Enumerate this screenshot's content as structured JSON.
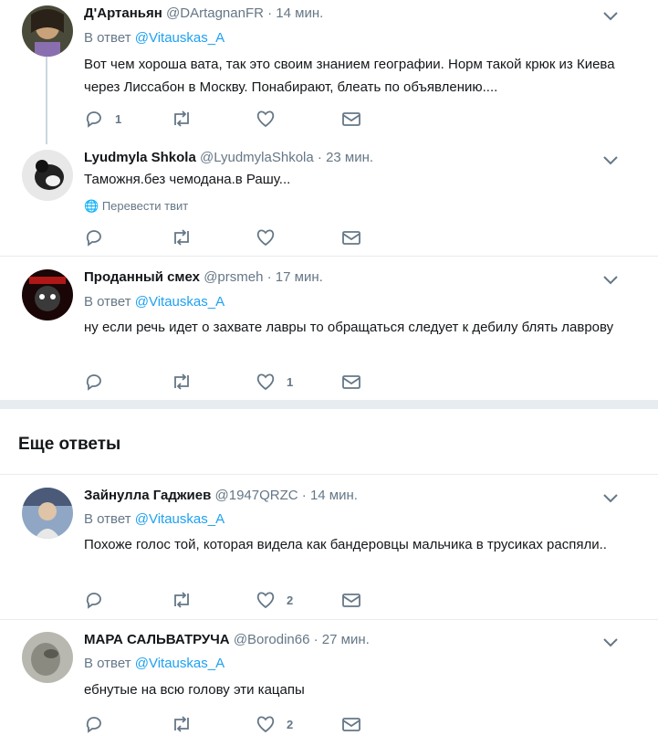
{
  "tweets": [
    {
      "name": "Д'Артаньян",
      "handle": "@DArtagnanFR",
      "time": "14 мин.",
      "reply_prefix": "В ответ",
      "reply_to": "@Vitauskas_A",
      "text": "Вот чем хороша вата, так это своим знанием географии. Норм такой крюк из Киева через Лиссабон в Москву. Понабирают, блеать по объявлению....",
      "reply_count": "1",
      "like_count": ""
    },
    {
      "name": "Lyudmyla Shkola",
      "handle": "@LyudmylaShkola",
      "time": "23 мин.",
      "text": "Таможня.без чемодана.в Рашу...",
      "translate": "Перевести твит",
      "reply_count": "",
      "like_count": ""
    },
    {
      "name": "Проданный смех",
      "handle": "@prsmeh",
      "time": "17 мин.",
      "reply_prefix": "В ответ",
      "reply_to": "@Vitauskas_A",
      "text": "ну если речь идет о захвате лавры то обращаться следует к дебилу блять лаврову",
      "reply_count": "",
      "like_count": "1"
    },
    {
      "name": "Зайнулла Гаджиев",
      "handle": "@1947QRZC",
      "time": "14 мин.",
      "reply_prefix": "В ответ",
      "reply_to": "@Vitauskas_A",
      "text": "Похоже голос той, которая видела как бандеровцы мальчика в трусиках распяли..",
      "reply_count": "",
      "like_count": "2"
    },
    {
      "name": "МАРА САЛЬВАТРУЧА",
      "handle": "@Borodin66",
      "time": "27 мин.",
      "reply_prefix": "В ответ",
      "reply_to": "@Vitauskas_A",
      "text": "ебнутые на всю голову эти кацапы",
      "reply_count": "",
      "like_count": "2"
    }
  ],
  "more_replies_label": "Еще ответы",
  "dot": "·",
  "colors": {
    "accent": "#1da1f2",
    "muted": "#657786",
    "separator": "#e6ecf0"
  }
}
